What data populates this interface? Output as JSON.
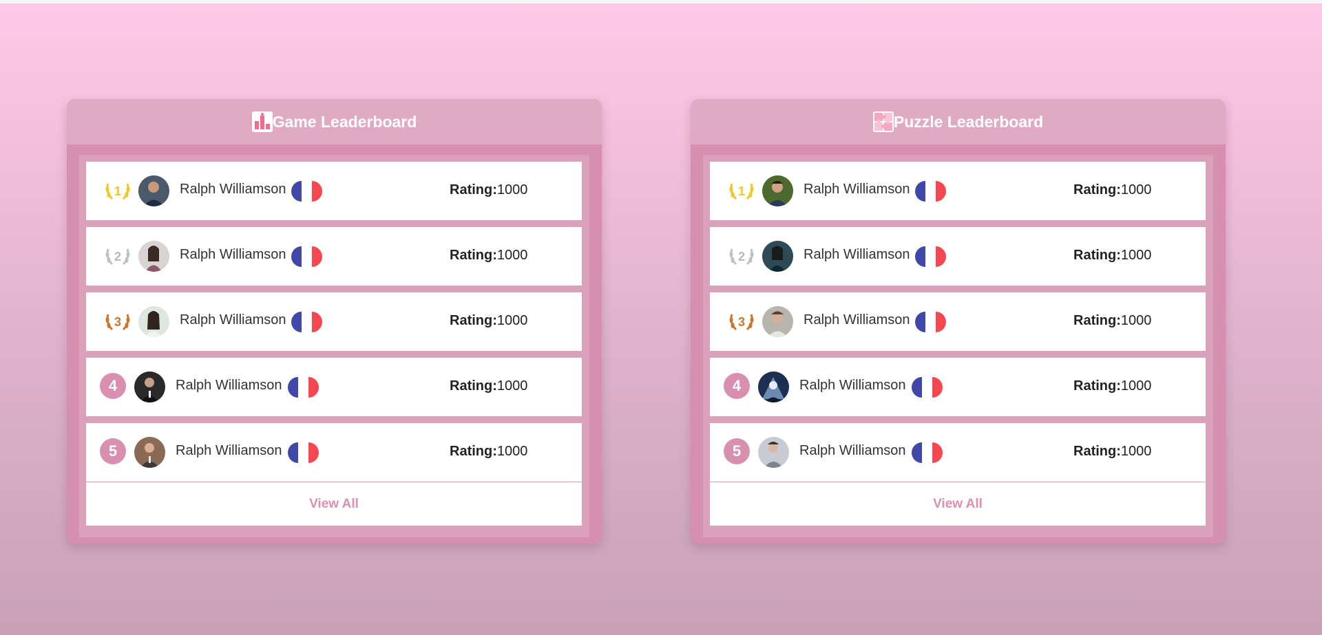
{
  "colors": {
    "accent_pink": "#d98fb0",
    "gold": "#f3c623",
    "silver": "#c0c0c0",
    "bronze": "#c7762b",
    "flag_blue": "#3f48a8",
    "flag_red": "#f4474f"
  },
  "boards": [
    {
      "title": "Game Leaderboard",
      "icon": "podium-icon",
      "view_all": "View All",
      "rows": [
        {
          "rank": "1",
          "medal": "gold-laurel-icon",
          "name": "Ralph Williamson",
          "rating_label": "Rating:",
          "rating_value": "1000"
        },
        {
          "rank": "2",
          "medal": "silver-laurel-icon",
          "name": "Ralph Williamson",
          "rating_label": "Rating:",
          "rating_value": "1000"
        },
        {
          "rank": "3",
          "medal": "bronze-laurel-icon",
          "name": "Ralph Williamson",
          "rating_label": "Rating:",
          "rating_value": "1000"
        },
        {
          "rank": "4",
          "medal": "",
          "name": "Ralph Williamson",
          "rating_label": "Rating:",
          "rating_value": "1000"
        },
        {
          "rank": "5",
          "medal": "",
          "name": "Ralph Williamson",
          "rating_label": "Rating:",
          "rating_value": "1000"
        }
      ]
    },
    {
      "title": "Puzzle Leaderboard",
      "icon": "puzzle-icon",
      "view_all": "View All",
      "rows": [
        {
          "rank": "1",
          "medal": "gold-laurel-icon",
          "name": "Ralph Williamson",
          "rating_label": "Rating:",
          "rating_value": "1000"
        },
        {
          "rank": "2",
          "medal": "silver-laurel-icon",
          "name": "Ralph Williamson",
          "rating_label": "Rating:",
          "rating_value": "1000"
        },
        {
          "rank": "3",
          "medal": "bronze-laurel-icon",
          "name": "Ralph Williamson",
          "rating_label": "Rating:",
          "rating_value": "1000"
        },
        {
          "rank": "4",
          "medal": "",
          "name": "Ralph Williamson",
          "rating_label": "Rating:",
          "rating_value": "1000"
        },
        {
          "rank": "5",
          "medal": "",
          "name": "Ralph Williamson",
          "rating_label": "Rating:",
          "rating_value": "1000"
        }
      ]
    }
  ]
}
